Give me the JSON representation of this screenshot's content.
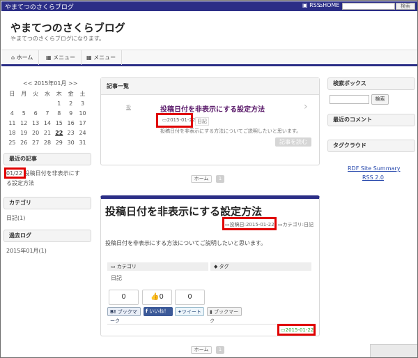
{
  "header": {
    "site_name": "やまてつのさくらブログ",
    "rss": "RSS",
    "home": "HOME",
    "search_button": "検索"
  },
  "blog": {
    "title": "やまてつのさくらブログ",
    "description": "やまてつのさくらブログになります。"
  },
  "nav": [
    "ホーム",
    "メニュー",
    "メニュー"
  ],
  "calendar": {
    "title": "<< 2015年01月 >>",
    "weekdays": [
      "日",
      "月",
      "火",
      "水",
      "木",
      "金",
      "土"
    ],
    "rows": [
      [
        "",
        "",
        "",
        "",
        "1",
        "2",
        "3"
      ],
      [
        "4",
        "5",
        "6",
        "7",
        "8",
        "9",
        "10"
      ],
      [
        "11",
        "12",
        "13",
        "14",
        "15",
        "16",
        "17"
      ],
      [
        "18",
        "19",
        "20",
        "21",
        "22",
        "23",
        "24"
      ],
      [
        "25",
        "26",
        "27",
        "28",
        "29",
        "30",
        "31"
      ]
    ],
    "today": "22"
  },
  "sidebar_left": {
    "recent_title": "最近の記事",
    "recent_date": "01/22",
    "recent_text_1": "投稿日付を非表示にす",
    "recent_text_2": "る設定方法",
    "category_title": "カテゴリ",
    "category_item": "日記(1)",
    "archive_title": "過去ログ",
    "archive_item": "2015年01月(1)"
  },
  "list": {
    "heading": "記事一覧",
    "thumb": "投",
    "post_title": "投稿日付を非表示にする設定方法",
    "date": "2015-01-22",
    "category": "日記",
    "excerpt": "投稿日付を非表示にする方法についてご説明したいと思います。",
    "read_more": "記事を読む"
  },
  "pager": {
    "home": "ホーム",
    "current": "1"
  },
  "article": {
    "title": "投稿日付を非表示にする設定方法",
    "posted_label": "投稿日:2015-01-22",
    "category_label": "カテゴリ:日記",
    "body": "投稿日付を非表示にする方法についてご説明したいと思います。",
    "category_heading": "カテゴリ",
    "tag_heading": "タグ",
    "category_value": "日記",
    "counts": [
      "0",
      "0",
      "0"
    ],
    "share_buttons": [
      "ブックマーク",
      "いいね！",
      "ツイート",
      "ブックマーク"
    ],
    "footer_date": "2015-01-22"
  },
  "sidebar_right": {
    "search_title": "検索ボックス",
    "search_button": "検索",
    "comment_title": "最近のコメント",
    "tag_title": "タグクラウド",
    "link1": "RDF Site Summary",
    "link2": "RSS 2.0"
  },
  "colors": {
    "accent": "#2b2e86",
    "highlight": "#e00000",
    "post_title": "#5a1a6a"
  }
}
